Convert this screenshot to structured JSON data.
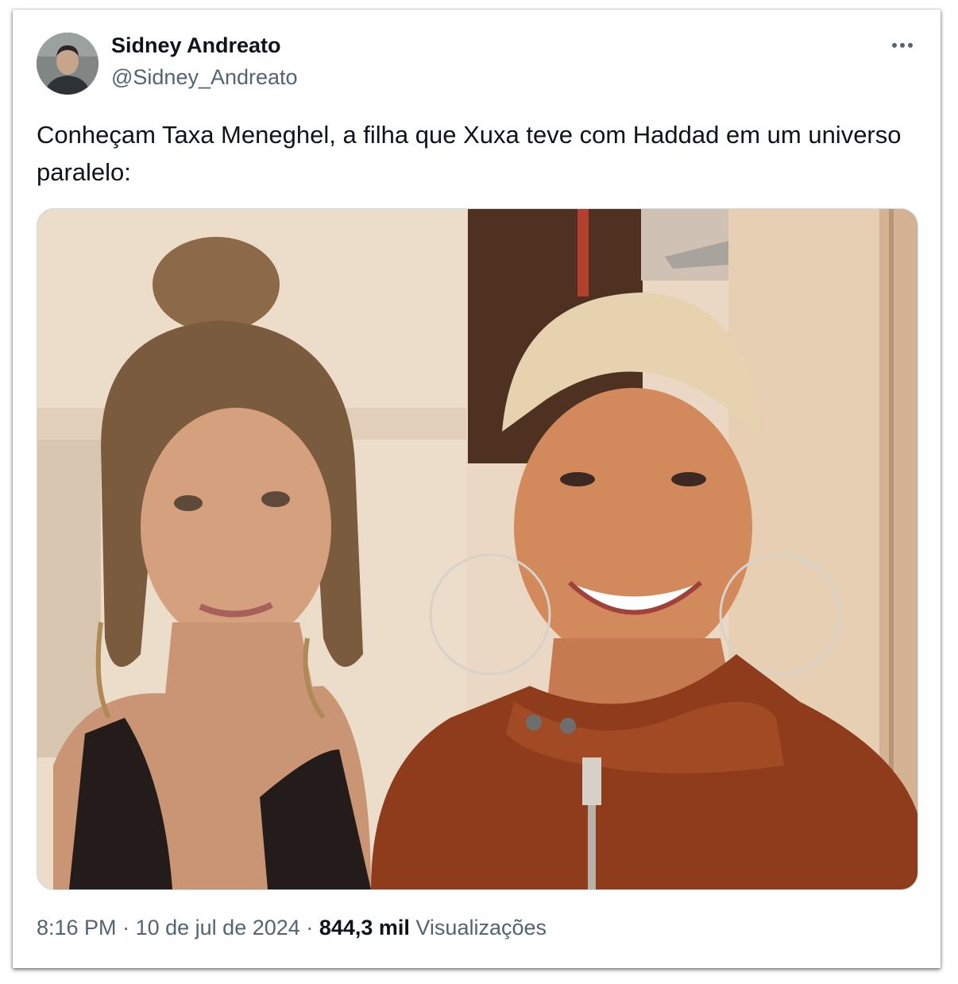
{
  "tweet": {
    "author_name": "Sidney Andreato",
    "author_handle": "@Sidney_Andreato",
    "text": "Conheçam Taxa Meneghel, a filha que Xuxa teve com Haddad em um universo paralelo:",
    "time": "8:16 PM",
    "separator": "·",
    "date": "10 de jul de 2024",
    "views_count": "844,3 mil",
    "views_label": "Visualizações",
    "more_icon": "more-horizontal-icon",
    "media_description_icon": "photo"
  },
  "colors": {
    "text_primary": "#0f1419",
    "text_secondary": "#536471",
    "border": "#cfd9de"
  }
}
